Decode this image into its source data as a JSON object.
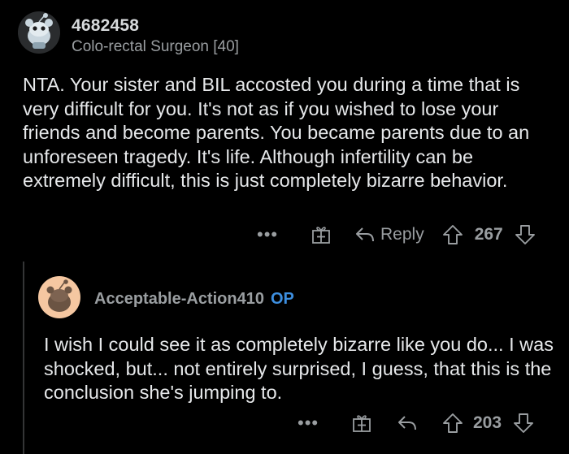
{
  "comment": {
    "username": "4682458",
    "flair": "Colo-rectal Surgeon [40]",
    "body": "NTA. Your sister and BIL accosted you during a time that is very difficult for you. It's not as if you wished to lose your friends and become parents. You became parents due to an unforeseen tragedy. It's life. Although infertility can be extremely difficult, this is just completely bizarre behavior.",
    "actions": {
      "more": "•••",
      "reply_label": "Reply",
      "score": "267"
    }
  },
  "reply": {
    "username": "Acceptable-Action410",
    "op_badge": "OP",
    "body": "I wish I could see it as completely bizarre like you do... I was shocked, but... not entirely surprised, I guess, that this is the conclusion she's jumping to.",
    "actions": {
      "more": "•••",
      "score": "203"
    }
  },
  "icons": [
    "snoo-avatar-icon",
    "more-icon",
    "award-icon",
    "reply-icon",
    "upvote-icon",
    "downvote-icon"
  ],
  "colors": {
    "background": "#000000",
    "text": "#e6e8ea",
    "meta": "#9a9ea1",
    "op": "#3d8fe0",
    "thread_line": "#343536"
  }
}
